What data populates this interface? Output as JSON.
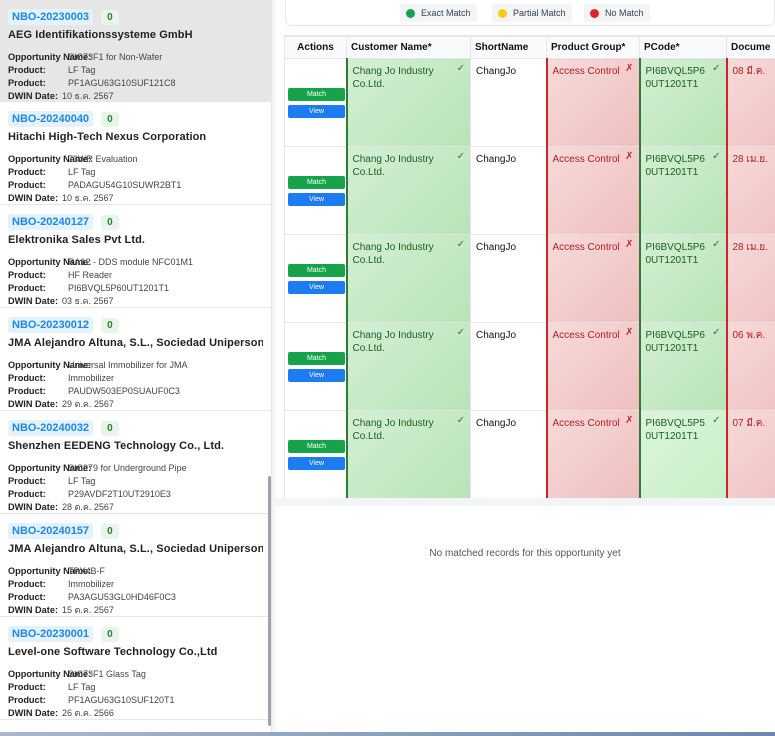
{
  "opportunities": [
    {
      "nbo": "NBO-20230003",
      "count": "0",
      "company": "AEG Identifikationssysteme GmbH",
      "opportunity_name": "SIC73F1 for Non-Wafer",
      "product": "LF Tag",
      "product_code": "PF1AGU63G10SUF121C8",
      "dwin_date": "10 ธ.ค. 2567"
    },
    {
      "nbo": "NBO-20240040",
      "count": "0",
      "company": "Hitachi High-Tech Nexus Corporation",
      "opportunity_name": "73WR Evaluation",
      "product": "LF Tag",
      "product_code": "PADAGU54G10SUWR2BT1",
      "dwin_date": "10 ธ.ค. 2567"
    },
    {
      "nbo": "NBO-20240127",
      "count": "0",
      "company": "Elektronika Sales Pvt Ltd.",
      "opportunity_name": "RA12 - DDS module NFC01M1",
      "product": "HF Reader",
      "product_code": "PI6BVQL5P60UT1201T1",
      "dwin_date": "03 ธ.ค. 2567"
    },
    {
      "nbo": "NBO-20230012",
      "count": "0",
      "company": "JMA Alejandro Altuna, S.L., Sociedad Unipersonal",
      "opportunity_name": "Universal Immobilizer for JMA",
      "product": "Immobilizer",
      "product_code": "PAUDW503EP0SUAUF0C3",
      "dwin_date": "29 ต.ค. 2567"
    },
    {
      "nbo": "NBO-20240032",
      "count": "0",
      "company": "Shenzhen EEDENG Technology Co., Ltd.",
      "opportunity_name": "SIC279 for Underground Pipe",
      "product": "LF Tag",
      "product_code": "P29AVDF2T10UT2910E3",
      "dwin_date": "28 ต.ค. 2567"
    },
    {
      "nbo": "NBO-20240157",
      "count": "0",
      "company": "JMA Alejandro Altuna, S.L., Sociedad Unipersonal",
      "opportunity_name": "TPX4B-F",
      "product": "Immobilizer",
      "product_code": "PA3AGU53GL0HD46F0C3",
      "dwin_date": "15 ต.ค. 2567"
    },
    {
      "nbo": "NBO-20230001",
      "count": "0",
      "company": "Level-one Software Technology Co.,Ltd",
      "opportunity_name": "SIC73F1 Glass Tag",
      "product": "LF Tag",
      "product_code": "PF1AGU63G10SUF120T1",
      "dwin_date": "26 ต.ค. 2566"
    }
  ],
  "labels": {
    "opportunity_name": "Opportunity Name:",
    "product": "Product:",
    "product_code": "Product:",
    "dwin_date": "DWIN Date:"
  },
  "legend": {
    "exact": {
      "label": "Exact Match",
      "color": "#16a34a"
    },
    "partial": {
      "label": "Partial Match",
      "color": "#facc15"
    },
    "none": {
      "label": "No Match",
      "color": "#dc2626"
    }
  },
  "table": {
    "headers": [
      "Actions",
      "Customer Name*",
      "ShortName",
      "Product Group*",
      "PCode*",
      "Docume"
    ],
    "match_label": "Match",
    "view_label": "View",
    "rows": [
      {
        "customer": "Chang Jo Industry Co.Ltd.",
        "customer_mark": "✓",
        "short": "ChangJo",
        "group": "Access Control",
        "group_mark": "✗",
        "pcode": "PI6BVQL5P60UT1201T1",
        "pcode_mark": "✓",
        "doc": "08 มี.ค.",
        "pcode_light": false
      },
      {
        "customer": "Chang Jo Industry Co.Ltd.",
        "customer_mark": "✓",
        "short": "ChangJo",
        "group": "Access Control",
        "group_mark": "✗",
        "pcode": "PI6BVQL5P60UT1201T1",
        "pcode_mark": "✓",
        "doc": "28 เม.ย.",
        "pcode_light": false
      },
      {
        "customer": "Chang Jo Industry Co.Ltd.",
        "customer_mark": "✓",
        "short": "ChangJo",
        "group": "Access Control",
        "group_mark": "✗",
        "pcode": "PI6BVQL5P60UT1201T1",
        "pcode_mark": "✓",
        "doc": "28 เม.ย.",
        "pcode_light": false
      },
      {
        "customer": "Chang Jo Industry Co.Ltd.",
        "customer_mark": "✓",
        "short": "ChangJo",
        "group": "Access Control",
        "group_mark": "✗",
        "pcode": "PI6BVQL5P60UT1201T1",
        "pcode_mark": "✓",
        "doc": "06 พ.ค.",
        "pcode_light": false
      },
      {
        "customer": "Chang Jo Industry Co.Ltd.",
        "customer_mark": "✓",
        "short": "ChangJo",
        "group": "Access Control",
        "group_mark": "✗",
        "pcode": "PI6BVQL5P50UT1201T1",
        "pcode_mark": "✓",
        "doc": "07 มี.ค.",
        "pcode_light": true
      }
    ]
  },
  "empty_message": "No matched records for this opportunity yet"
}
